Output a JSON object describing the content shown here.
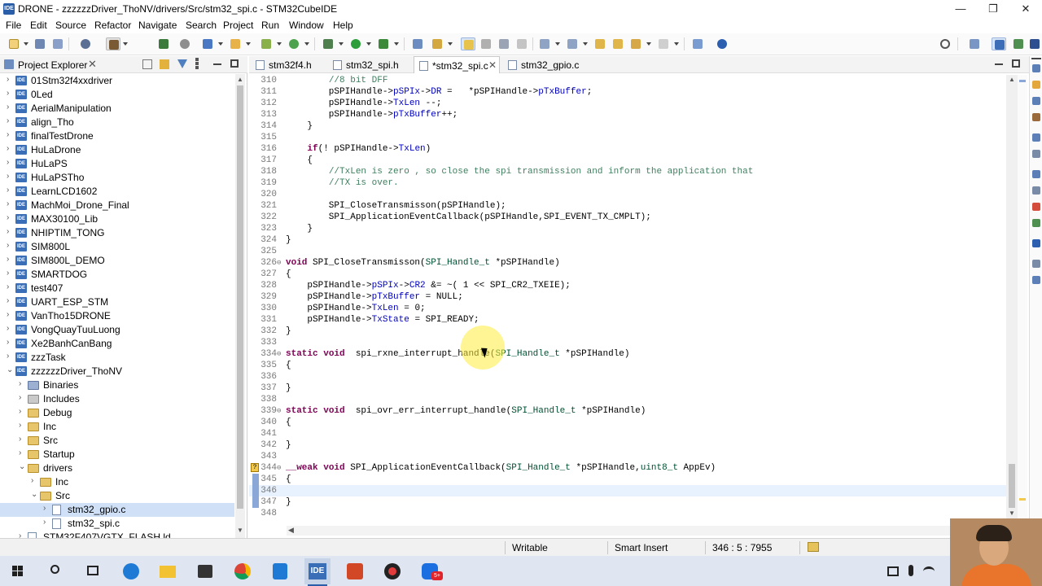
{
  "window": {
    "title": "DRONE - zzzzzzDriver_ThoNV/drivers/Src/stm32_spi.c - STM32CubeIDE",
    "app_badge": "IDE"
  },
  "menu": [
    "File",
    "Edit",
    "Source",
    "Refactor",
    "Navigate",
    "Search",
    "Project",
    "Run",
    "Window",
    "Help"
  ],
  "explorer": {
    "title": "Project Explorer",
    "items": [
      {
        "label": "01Stm32f4xxdriver",
        "icon": "ide-project-icon",
        "depth": 0,
        "expanded": false
      },
      {
        "label": "0Led",
        "icon": "ide-project-icon",
        "depth": 0,
        "expanded": false
      },
      {
        "label": "AerialManipulation",
        "icon": "ide-project-icon",
        "depth": 0,
        "expanded": false
      },
      {
        "label": "align_Tho",
        "icon": "ide-project-icon",
        "depth": 0,
        "expanded": false
      },
      {
        "label": "finalTestDrone",
        "icon": "ide-project-icon",
        "depth": 0,
        "expanded": false
      },
      {
        "label": "HuLaDrone",
        "icon": "ide-project-icon",
        "depth": 0,
        "expanded": false
      },
      {
        "label": "HuLaPS",
        "icon": "ide-project-icon",
        "depth": 0,
        "expanded": false
      },
      {
        "label": "HuLaPSTho",
        "icon": "ide-project-icon",
        "depth": 0,
        "expanded": false
      },
      {
        "label": "LearnLCD1602",
        "icon": "ide-project-icon",
        "depth": 0,
        "expanded": false
      },
      {
        "label": "MachMoi_Drone_Final",
        "icon": "ide-project-icon",
        "depth": 0,
        "expanded": false
      },
      {
        "label": "MAX30100_Lib",
        "icon": "ide-project-icon",
        "depth": 0,
        "expanded": false
      },
      {
        "label": "NHIPTIM_TONG",
        "icon": "ide-project-icon",
        "depth": 0,
        "expanded": false
      },
      {
        "label": "SIM800L",
        "icon": "ide-project-icon",
        "depth": 0,
        "expanded": false
      },
      {
        "label": "SIM800L_DEMO",
        "icon": "ide-project-icon",
        "depth": 0,
        "expanded": false
      },
      {
        "label": "SMARTDOG",
        "icon": "ide-project-icon",
        "depth": 0,
        "expanded": false
      },
      {
        "label": "test407",
        "icon": "ide-project-icon",
        "depth": 0,
        "expanded": false
      },
      {
        "label": "UART_ESP_STM",
        "icon": "ide-project-icon",
        "depth": 0,
        "expanded": false
      },
      {
        "label": "VanTho15DRONE",
        "icon": "ide-project-icon",
        "depth": 0,
        "expanded": false
      },
      {
        "label": "VongQuayTuuLuong",
        "icon": "ide-project-icon",
        "depth": 0,
        "expanded": false
      },
      {
        "label": "Xe2BanhCanBang",
        "icon": "ide-project-icon",
        "depth": 0,
        "expanded": false
      },
      {
        "label": "zzzTask",
        "icon": "ide-project-icon",
        "depth": 0,
        "expanded": false
      },
      {
        "label": "zzzzzzDriver_ThoNV",
        "icon": "ide-project-icon",
        "depth": 0,
        "expanded": true
      },
      {
        "label": "Binaries",
        "icon": "binaries-icon",
        "depth": 1,
        "expanded": false
      },
      {
        "label": "Includes",
        "icon": "includes-icon",
        "depth": 1,
        "expanded": false
      },
      {
        "label": "Debug",
        "icon": "folder-icon",
        "depth": 1,
        "expanded": false
      },
      {
        "label": "Inc",
        "icon": "folder-icon",
        "depth": 1,
        "expanded": false
      },
      {
        "label": "Src",
        "icon": "folder-icon",
        "depth": 1,
        "expanded": false
      },
      {
        "label": "Startup",
        "icon": "folder-icon",
        "depth": 1,
        "expanded": false
      },
      {
        "label": "drivers",
        "icon": "folder-icon",
        "depth": 1,
        "expanded": true
      },
      {
        "label": "Inc",
        "icon": "folder-icon",
        "depth": 2,
        "expanded": false
      },
      {
        "label": "Src",
        "icon": "folder-icon",
        "depth": 2,
        "expanded": true
      },
      {
        "label": "stm32_gpio.c",
        "icon": "c-file-icon",
        "depth": 3,
        "expanded": false,
        "selected": true
      },
      {
        "label": "stm32_spi.c",
        "icon": "c-file-icon",
        "depth": 3,
        "expanded": false
      },
      {
        "label": "STM32F407VGTX_FLASH.ld",
        "icon": "ld-file-icon",
        "depth": 1,
        "expanded": false
      }
    ]
  },
  "editor": {
    "tabs": [
      {
        "label": "stm32f4.h",
        "active": false
      },
      {
        "label": "stm32_spi.h",
        "active": false
      },
      {
        "label": "*stm32_spi.c",
        "active": true
      },
      {
        "label": "stm32_gpio.c",
        "active": false
      }
    ],
    "lines": [
      {
        "n": "310",
        "t": "        //8 bit DFF"
      },
      {
        "n": "311",
        "t": "        pSPIHandle->pSPIx->DR =   *pSPIHandle->pTxBuffer;"
      },
      {
        "n": "312",
        "t": "        pSPIHandle->TxLen --;"
      },
      {
        "n": "313",
        "t": "        pSPIHandle->pTxBuffer++;"
      },
      {
        "n": "314",
        "t": "    }"
      },
      {
        "n": "315",
        "t": ""
      },
      {
        "n": "316",
        "t": "    if(! pSPIHandle->TxLen)"
      },
      {
        "n": "317",
        "t": "    {"
      },
      {
        "n": "318",
        "t": "        //TxLen is zero , so close the spi transmission and inform the application that"
      },
      {
        "n": "319",
        "t": "        //TX is over."
      },
      {
        "n": "320",
        "t": ""
      },
      {
        "n": "321",
        "t": "        SPI_CloseTransmisson(pSPIHandle);"
      },
      {
        "n": "322",
        "t": "        SPI_ApplicationEventCallback(pSPIHandle,SPI_EVENT_TX_CMPLT);"
      },
      {
        "n": "323",
        "t": "    }"
      },
      {
        "n": "324",
        "t": "}"
      },
      {
        "n": "325",
        "t": ""
      },
      {
        "n": "326",
        "t": "void SPI_CloseTransmisson(SPI_Handle_t *pSPIHandle)",
        "fold": true
      },
      {
        "n": "327",
        "t": "{"
      },
      {
        "n": "328",
        "t": "    pSPIHandle->pSPIx->CR2 &= ~( 1 << SPI_CR2_TXEIE);"
      },
      {
        "n": "329",
        "t": "    pSPIHandle->pTxBuffer = NULL;"
      },
      {
        "n": "330",
        "t": "    pSPIHandle->TxLen = 0;"
      },
      {
        "n": "331",
        "t": "    pSPIHandle->TxState = SPI_READY;"
      },
      {
        "n": "332",
        "t": "}"
      },
      {
        "n": "333",
        "t": ""
      },
      {
        "n": "334",
        "t": "static void  spi_rxne_interrupt_handle(SPI_Handle_t *pSPIHandle)",
        "fold": true
      },
      {
        "n": "335",
        "t": "{"
      },
      {
        "n": "336",
        "t": ""
      },
      {
        "n": "337",
        "t": "}"
      },
      {
        "n": "338",
        "t": ""
      },
      {
        "n": "339",
        "t": "static void  spi_ovr_err_interrupt_handle(SPI_Handle_t *pSPIHandle)",
        "fold": true
      },
      {
        "n": "340",
        "t": "{"
      },
      {
        "n": "341",
        "t": ""
      },
      {
        "n": "342",
        "t": "}"
      },
      {
        "n": "343",
        "t": ""
      },
      {
        "n": "344",
        "t": "__weak void SPI_ApplicationEventCallback(SPI_Handle_t *pSPIHandle,uint8_t AppEv)",
        "fold": true
      },
      {
        "n": "345",
        "t": "{"
      },
      {
        "n": "346",
        "t": "",
        "current": true
      },
      {
        "n": "347",
        "t": "}"
      },
      {
        "n": "348",
        "t": ""
      }
    ]
  },
  "status": {
    "mode": "Writable",
    "insert": "Smart Insert",
    "position": "346 : 5 : 7955"
  },
  "taskbar": {
    "ide_label": "IDE",
    "chat_badge": "5+"
  }
}
